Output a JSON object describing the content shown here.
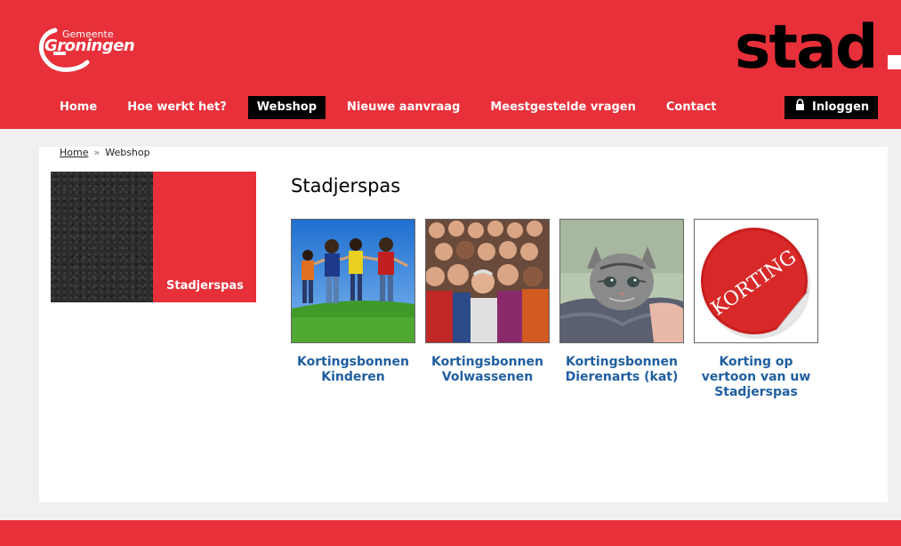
{
  "header": {
    "logo_small": "Gemeente",
    "logo_big": "Groningen",
    "brand": "stad",
    "nav": [
      {
        "label": "Home",
        "active": false
      },
      {
        "label": "Hoe werkt het?",
        "active": false
      },
      {
        "label": "Webshop",
        "active": true
      },
      {
        "label": "Nieuwe aanvraag",
        "active": false
      },
      {
        "label": "Meestgestelde vragen",
        "active": false
      },
      {
        "label": "Contact",
        "active": false
      }
    ],
    "login_label": "Inloggen"
  },
  "breadcrumb": {
    "home": "Home",
    "separator": "»",
    "current": "Webshop"
  },
  "sidebar": {
    "label": "Stadjerspas"
  },
  "main": {
    "title": "Stadjerspas",
    "products": [
      {
        "label_line1": "Kortingsbonnen",
        "label_line2": "Kinderen",
        "label_line3": "",
        "image": "children-playing"
      },
      {
        "label_line1": "Kortingsbonnen",
        "label_line2": "Volwassenen",
        "label_line3": "",
        "image": "crowd-of-people"
      },
      {
        "label_line1": "Kortingsbonnen",
        "label_line2": "Dierenarts (kat)",
        "label_line3": "",
        "image": "kitten"
      },
      {
        "label_line1": "Korting op",
        "label_line2": "vertoon van uw",
        "label_line3": "Stadjerspas",
        "image": "korting-sticker"
      }
    ],
    "sticker_text": "KORTING"
  },
  "colors": {
    "brand_red": "#e8303a",
    "link_blue": "#1f5fa0",
    "black": "#000000"
  }
}
